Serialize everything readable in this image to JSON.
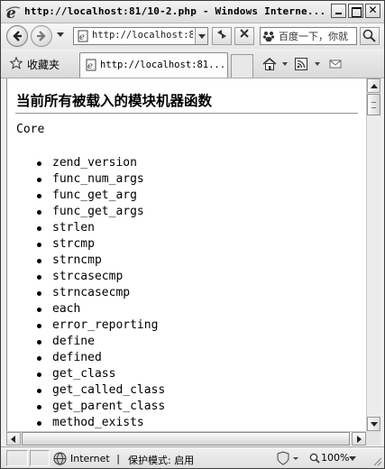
{
  "window": {
    "title": "http://localhost:81/10-2.php - Windows Interne...",
    "caption_close": "✕"
  },
  "address_bar": {
    "url": "http://localhost:8",
    "icon": "page-icon"
  },
  "search": {
    "value": "百度一下，你就",
    "icon": "baidu-logo"
  },
  "favorites": {
    "label": "收藏夹"
  },
  "tab": {
    "label": "http://localhost:81..."
  },
  "toolbar_icons": [
    "back-icon",
    "forward-icon",
    "refresh-icon",
    "stop-icon",
    "search-go-icon",
    "home-icon",
    "feeds-icon",
    "mail-icon"
  ],
  "page": {
    "heading": "当前所有被载入的模块机器函数",
    "module": "Core",
    "functions": [
      "zend_version",
      "func_num_args",
      "func_get_arg",
      "func_get_args",
      "strlen",
      "strcmp",
      "strncmp",
      "strcasecmp",
      "strncasecmp",
      "each",
      "error_reporting",
      "define",
      "defined",
      "get_class",
      "get_called_class",
      "get_parent_class",
      "method_exists"
    ]
  },
  "status": {
    "zone": "Internet",
    "separator": "|",
    "protected_mode": "保护模式: 启用",
    "zoom": "100%"
  },
  "colors": {
    "chrome": "#f0f0f0",
    "content_bg": "#ffffff",
    "border": "#3c3c3c"
  }
}
